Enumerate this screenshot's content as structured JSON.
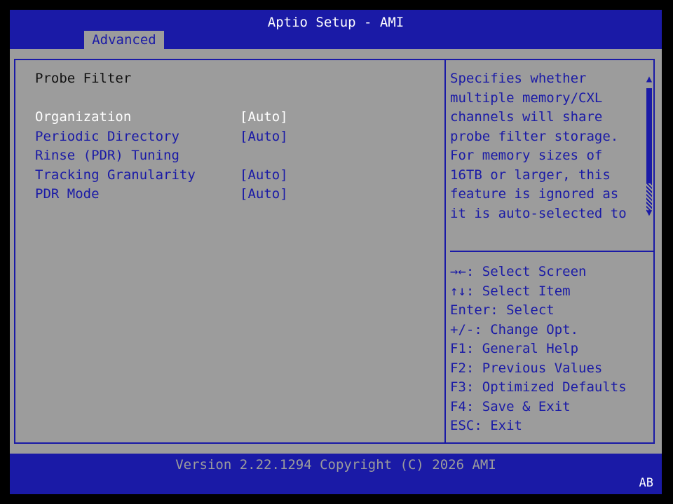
{
  "header": {
    "title": "Aptio Setup - AMI",
    "tabs": [
      {
        "label": "Advanced"
      }
    ]
  },
  "section_title": "Probe Filter",
  "settings": [
    {
      "label": "Organization",
      "value": "[Auto]"
    },
    {
      "label": "Periodic Directory",
      "label_line2": "Rinse (PDR) Tuning",
      "value": "[Auto]"
    },
    {
      "label": "Tracking Granularity",
      "value": "[Auto]"
    },
    {
      "label": "PDR Mode",
      "value": "[Auto]"
    }
  ],
  "help_text": [
    "Specifies whether",
    "multiple memory/CXL",
    "channels will share",
    "probe filter storage.",
    "For memory sizes of",
    "16TB or larger, this",
    "feature is ignored as",
    "it is auto-selected to"
  ],
  "scroll_arrows": {
    "up": "▲",
    "down": "▼"
  },
  "key_help": [
    {
      "key": "→←",
      "desc": ": Select Screen"
    },
    {
      "key": "↑↓",
      "desc": ": Select Item"
    },
    {
      "key": "",
      "desc": "Enter: Select"
    },
    {
      "key": "",
      "desc": "+/-: Change Opt."
    },
    {
      "key": "",
      "desc": "F1: General Help"
    },
    {
      "key": "",
      "desc": "F2: Previous Values"
    },
    {
      "key": "",
      "desc": "F3: Optimized Defaults"
    },
    {
      "key": "",
      "desc": "F4: Save & Exit"
    },
    {
      "key": "",
      "desc": "ESC: Exit"
    }
  ],
  "footer": {
    "version": "Version 2.22.1294 Copyright (C) 2026 AMI",
    "corner": "AB"
  },
  "colors": {
    "background": "#9c9c9c",
    "accent": "#1a1aa6",
    "highlight": "#ffffff"
  }
}
